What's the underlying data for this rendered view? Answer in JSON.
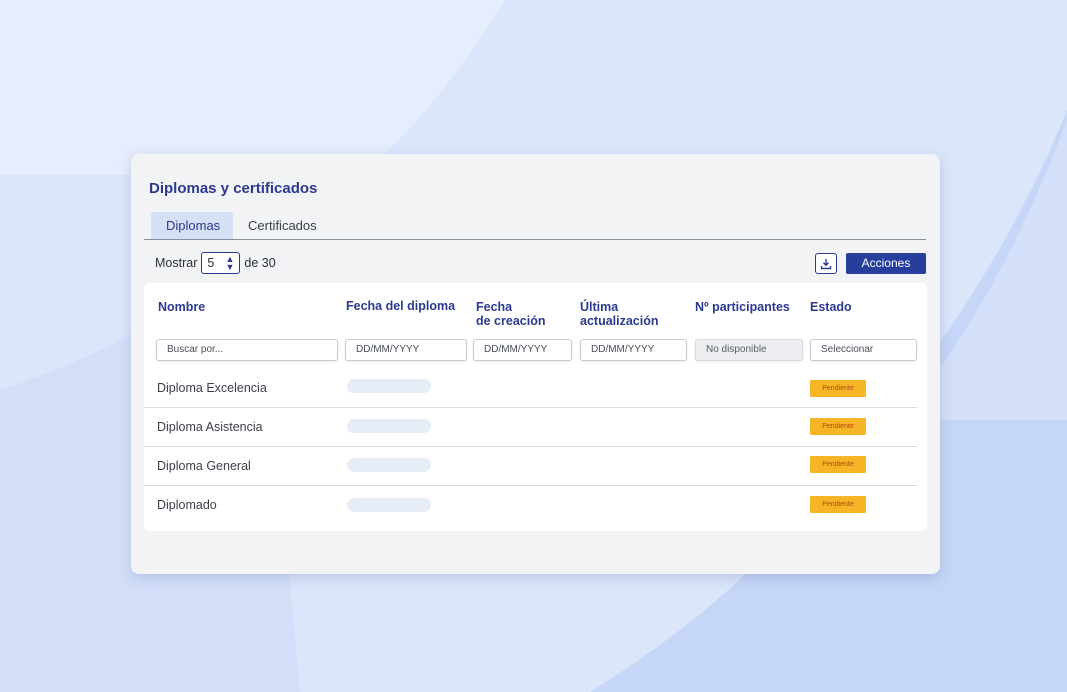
{
  "page": {
    "title": "Diplomas y certificados"
  },
  "tabs": [
    {
      "label": "Diplomas",
      "active": true
    },
    {
      "label": "Certificados",
      "active": false
    }
  ],
  "toolbar": {
    "show_label": "Mostrar",
    "page_size": "5",
    "of_label": "de 30",
    "download_icon": "download-icon",
    "actions_label": "Acciones"
  },
  "table": {
    "headers": {
      "name": "Nombre",
      "diploma_date": "Fecha del diploma",
      "created_line1": "Fecha",
      "created_line2": "de creación",
      "updated_line1": "Última",
      "updated_line2": "actualización",
      "participants": "Nº participantes",
      "status": "Estado"
    },
    "filters": {
      "name": "Buscar por...",
      "diploma_date": "DD/MM/YYYY",
      "created": "DD/MM/YYYY",
      "updated": "DD/MM/YYYY",
      "participants": "No disponible",
      "status": "Seleccionar"
    },
    "rows": [
      {
        "name": "Diploma Excelencia",
        "status": "Pendiente"
      },
      {
        "name": "Diploma Asistencia",
        "status": "Pendiente"
      },
      {
        "name": "Diploma General",
        "status": "Pendiente"
      },
      {
        "name": "Diplomado",
        "status": "Pendiente"
      }
    ]
  },
  "colors": {
    "accent": "#2b3a8f",
    "primary_button": "#263f9c",
    "status_pending": "#f6b527",
    "background": "#dbe6fb"
  }
}
